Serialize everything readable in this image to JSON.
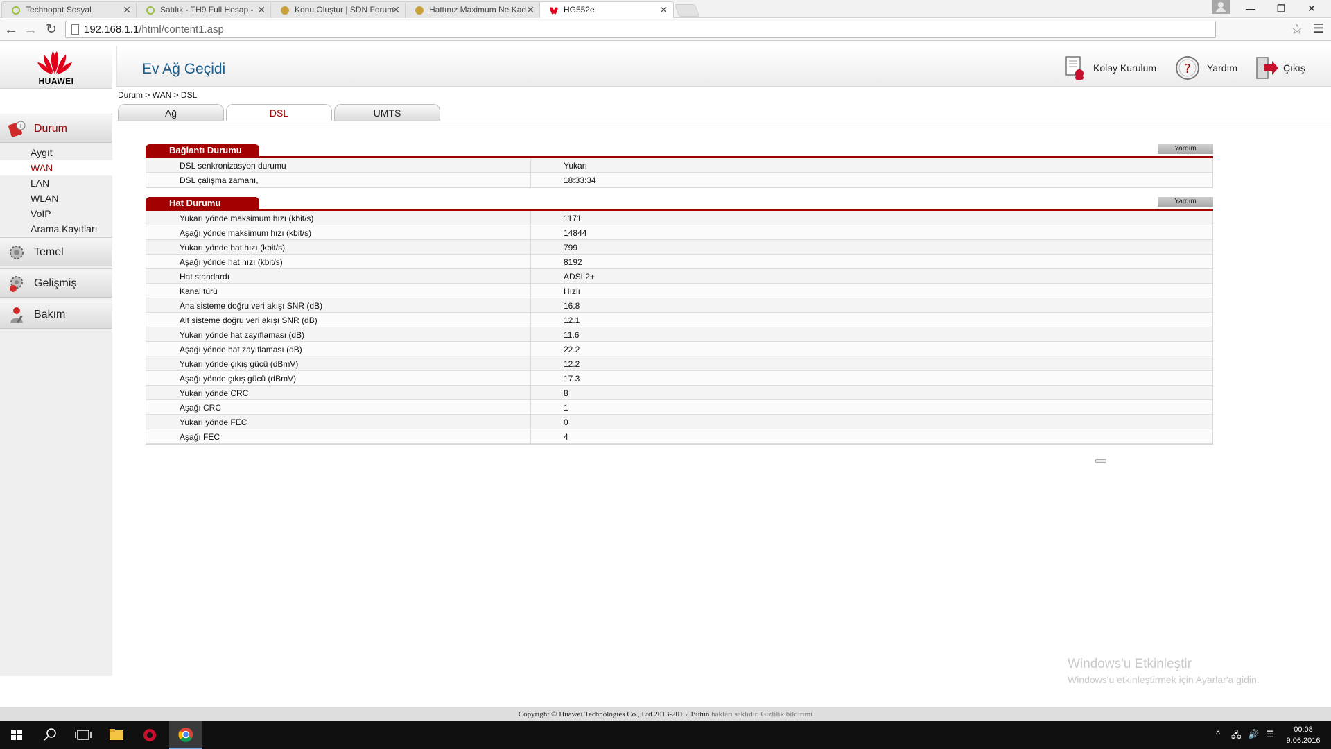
{
  "browser": {
    "tabs": [
      {
        "title": "Technopat Sosyal"
      },
      {
        "title": "Satılık - TH9 Full Hesap -"
      },
      {
        "title": "Konu Oluştur | SDN Forum"
      },
      {
        "title": "Hattınız Maximum Ne Kad"
      },
      {
        "title": "HG552e"
      }
    ],
    "url_host": "192.168.1.1",
    "url_path": "/html/content1.asp"
  },
  "router": {
    "brand": "HUAWEI",
    "title": "Ev Ağ Geçidi",
    "header_buttons": {
      "setup": "Kolay Kurulum",
      "help": "Yardım",
      "logout": "Çıkış"
    },
    "breadcrumb": "Durum > WAN > DSL",
    "subtabs": [
      "Ağ",
      "DSL",
      "UMTS"
    ],
    "sidebar": {
      "status": "Durum",
      "status_items": [
        "Aygıt",
        "WAN",
        "LAN",
        "WLAN",
        "VoIP",
        "Arama Kayıtları"
      ],
      "basic": "Temel",
      "advanced": "Gelişmiş",
      "maintenance": "Bakım"
    },
    "connection": {
      "title": "Bağlantı Durumu",
      "help": "Yardım",
      "rows": [
        {
          "k": "DSL senkronizasyon durumu",
          "v": "Yukarı"
        },
        {
          "k": "DSL çalışma zamanı,",
          "v": "18:33:34"
        }
      ]
    },
    "line": {
      "title": "Hat Durumu",
      "help": "Yardım",
      "rows": [
        {
          "k": "Yukarı yönde maksimum hızı (kbit/s)",
          "v": "1171"
        },
        {
          "k": "Aşağı yönde maksimum hızı (kbit/s)",
          "v": "14844"
        },
        {
          "k": "Yukarı yönde hat hızı (kbit/s)",
          "v": "799"
        },
        {
          "k": "Aşağı yönde hat hızı (kbit/s)",
          "v": "8192"
        },
        {
          "k": "Hat standardı",
          "v": "ADSL2+"
        },
        {
          "k": "Kanal türü",
          "v": "Hızlı"
        },
        {
          "k": "Ana sisteme doğru veri akışı SNR (dB)",
          "v": "16.8"
        },
        {
          "k": "Alt sisteme doğru veri akışı SNR (dB)",
          "v": "12.1"
        },
        {
          "k": "Yukarı yönde hat zayıflaması (dB)",
          "v": "11.6"
        },
        {
          "k": "Aşağı yönde hat zayıflaması (dB)",
          "v": "22.2"
        },
        {
          "k": "Yukarı yönde çıkış gücü (dBmV)",
          "v": "12.2"
        },
        {
          "k": "Aşağı yönde çıkış gücü (dBmV)",
          "v": "17.3"
        },
        {
          "k": "Yukarı yönde CRC",
          "v": "8"
        },
        {
          "k": "Aşağı CRC",
          "v": "1"
        },
        {
          "k": "Yukarı yönde FEC",
          "v": "0"
        },
        {
          "k": "Aşağı FEC",
          "v": "4"
        }
      ]
    },
    "footer": {
      "copyright": "Copyright © Huawei Technologies Co., Ltd.2013-2015. Bütün",
      "rights": "hakları saklıdır.",
      "privacy": "Gizlilik bildirimi"
    }
  },
  "windows": {
    "watermark_title": "Windows'u Etkinleştir",
    "watermark_sub": "Windows'u etkinleştirmek için Ayarlar'a gidin.",
    "time": "00:08",
    "date": "9.06.2016"
  },
  "colors": {
    "accent_red": "#a30000",
    "title_blue": "#1c5c8a",
    "huawei_red": "#e2001a"
  }
}
